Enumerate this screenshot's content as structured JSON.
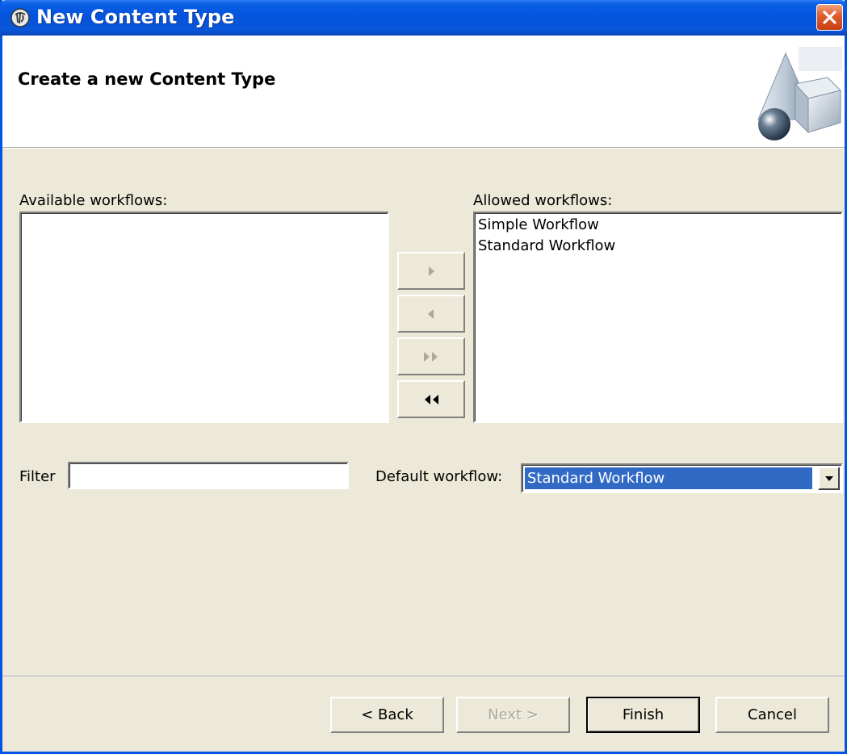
{
  "window": {
    "title": "New Content Type",
    "close_icon": "close-icon"
  },
  "header": {
    "title": "Create a new Content Type",
    "graphic": "wizard-shapes-graphic"
  },
  "available": {
    "label": "Available workflows:",
    "items": []
  },
  "allowed": {
    "label": "Allowed workflows:",
    "items": [
      "Simple Workflow",
      "Standard Workflow"
    ]
  },
  "move_buttons": [
    {
      "name": "add",
      "icon": "triangle-right-icon",
      "enabled": false
    },
    {
      "name": "remove",
      "icon": "triangle-left-icon",
      "enabled": false
    },
    {
      "name": "add-all",
      "icon": "double-triangle-right-icon",
      "enabled": false
    },
    {
      "name": "remove-all",
      "icon": "double-triangle-left-icon",
      "enabled": true
    }
  ],
  "filter": {
    "label": "Filter",
    "value": "",
    "placeholder": ""
  },
  "default_workflow": {
    "label": "Default workflow:",
    "selected": "Standard Workflow",
    "dropdown_icon": "chevron-down-icon"
  },
  "footer": {
    "back_label": "< Back",
    "next_label": "Next >",
    "finish_label": "Finish",
    "cancel_label": "Cancel"
  },
  "colors": {
    "titlebar": "#0453dd",
    "dialog_bg": "#ece9d8",
    "selection": "#316ac5",
    "disabled_text": "#aca899"
  }
}
